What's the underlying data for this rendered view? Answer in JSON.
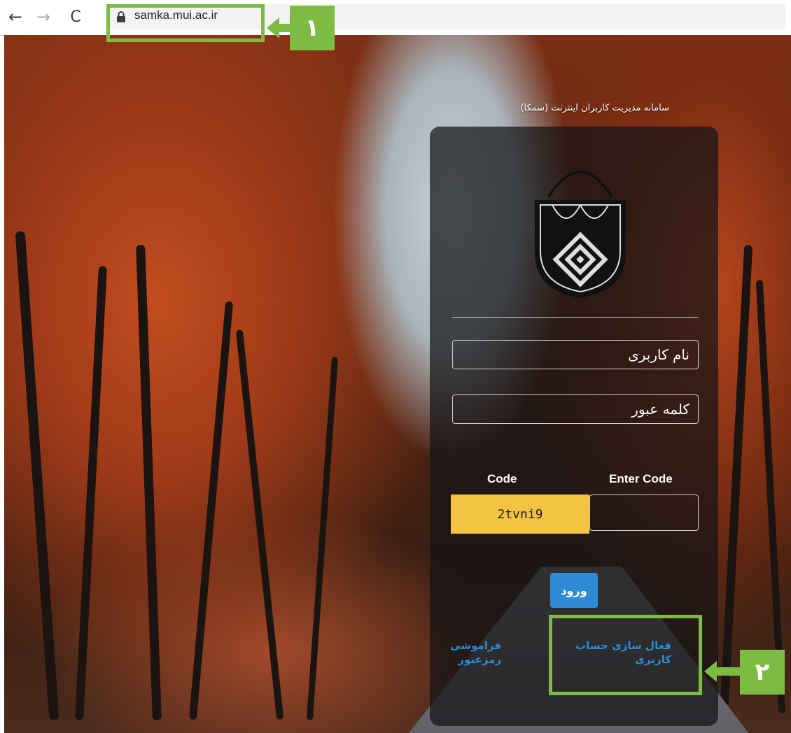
{
  "browser": {
    "url": "samka.mui.ac.ir",
    "back_icon": "←",
    "forward_icon": "→",
    "reload_icon": "C"
  },
  "login": {
    "app_title": "سامانه مدیریت کاربران اینترنت (سمکا)",
    "username_placeholder": "نام کاربری",
    "password_placeholder": "کلمه عبور",
    "code_label": "Code",
    "enter_code_label": "Enter Code",
    "captcha_value": "2tvni9",
    "login_button": "ورود",
    "activate_account_link": "فعال سازی حساب کاربری",
    "forgot_password_link": "فراموشی رمزعبور"
  },
  "callouts": {
    "step1": "۱",
    "step2": "۲",
    "highlight_color": "#7dbb43"
  },
  "colors": {
    "captcha_bg": "#f4c441",
    "button_blue": "#2d8bd6"
  }
}
